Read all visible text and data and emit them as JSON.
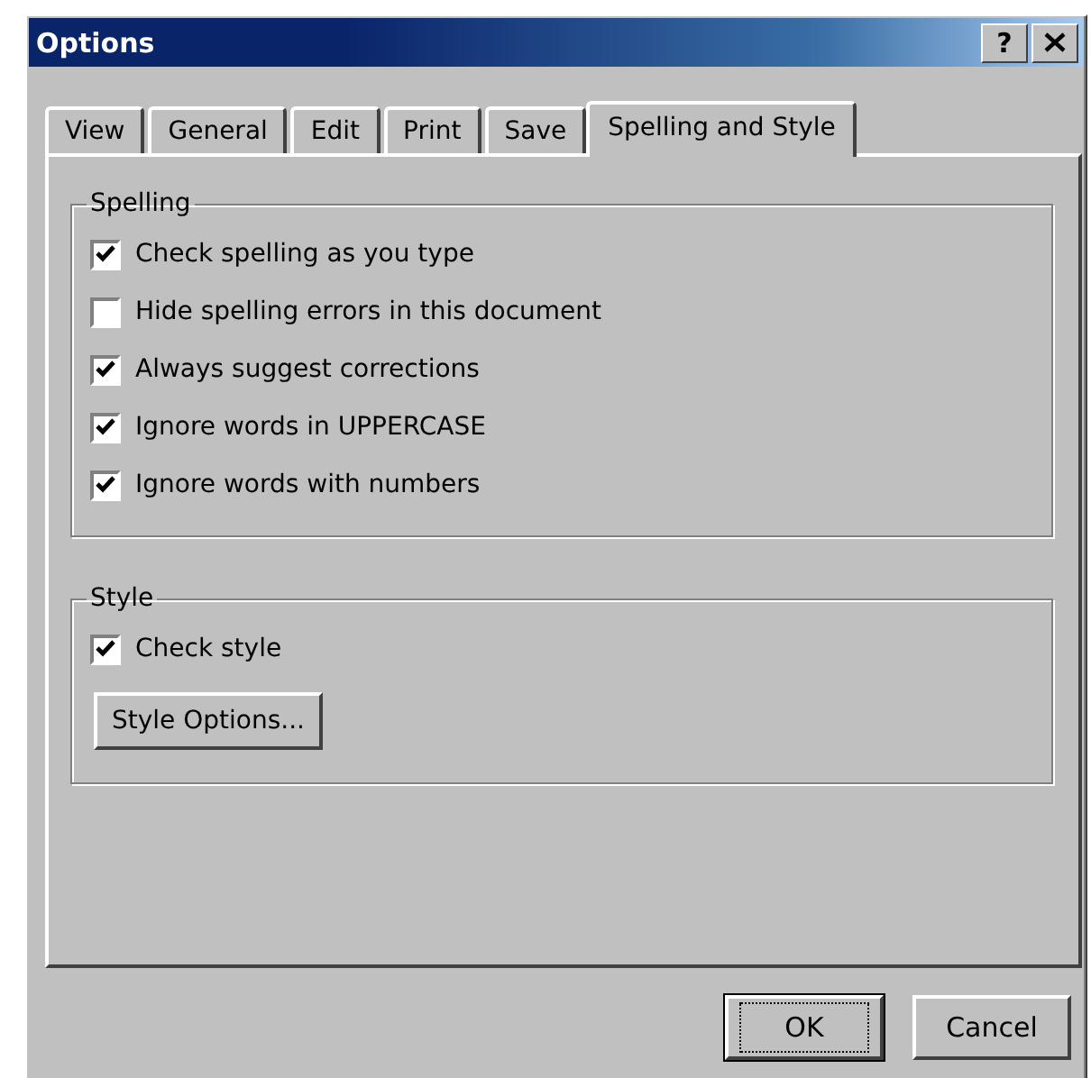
{
  "window": {
    "title": "Options",
    "help_button": "?"
  },
  "tabs": [
    {
      "label": "View",
      "selected": false
    },
    {
      "label": "General",
      "selected": false
    },
    {
      "label": "Edit",
      "selected": false
    },
    {
      "label": "Print",
      "selected": false
    },
    {
      "label": "Save",
      "selected": false
    },
    {
      "label": "Spelling and Style",
      "selected": true
    }
  ],
  "groups": [
    {
      "title": "Spelling",
      "items": [
        {
          "kind": "checkbox",
          "label": "Check spelling as you type",
          "checked": true
        },
        {
          "kind": "checkbox",
          "label": "Hide spelling errors in this document",
          "checked": false
        },
        {
          "kind": "checkbox",
          "label": "Always suggest corrections",
          "checked": true
        },
        {
          "kind": "checkbox",
          "label": "Ignore words in UPPERCASE",
          "checked": true
        },
        {
          "kind": "checkbox",
          "label": "Ignore words with numbers",
          "checked": true
        }
      ]
    },
    {
      "title": "Style",
      "items": [
        {
          "kind": "checkbox",
          "label": "Check style",
          "checked": true
        },
        {
          "kind": "button",
          "label": "Style Options..."
        }
      ]
    }
  ],
  "buttons": [
    {
      "label": "OK",
      "default": true
    },
    {
      "label": "Cancel",
      "default": false
    }
  ]
}
